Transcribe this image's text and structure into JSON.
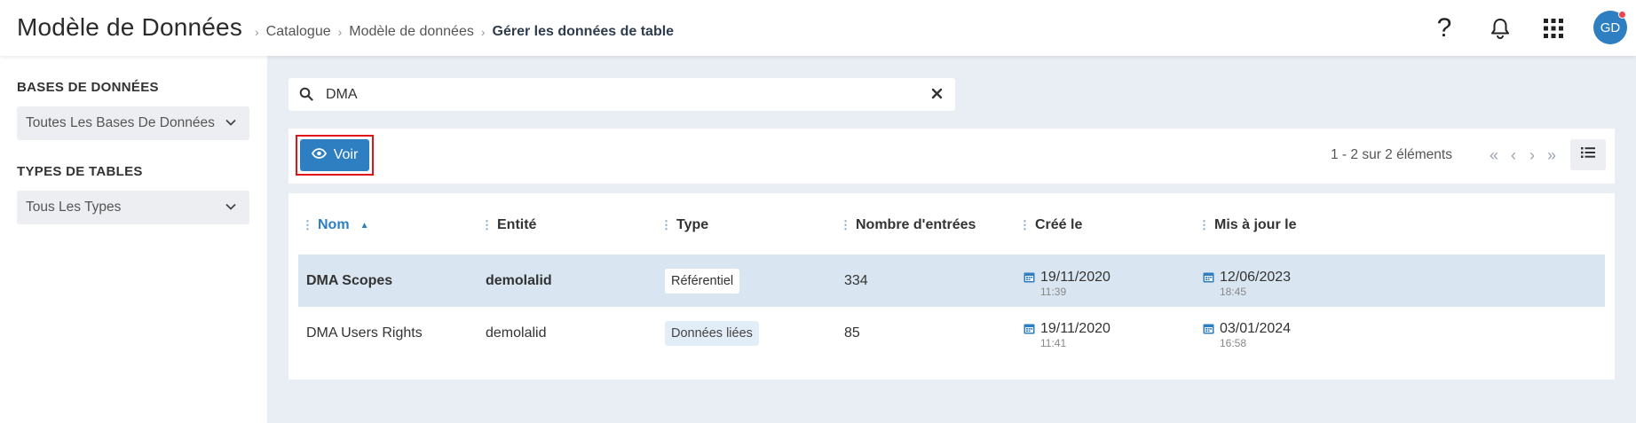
{
  "header": {
    "title": "Modèle de Données",
    "breadcrumb": [
      "Catalogue",
      "Modèle de données",
      "Gérer les données de table"
    ],
    "avatar_initials": "GD",
    "help_glyph": "?",
    "icons": [
      "help-icon",
      "bell-icon",
      "apps-grid-icon"
    ]
  },
  "sidebar": {
    "databases_heading": "BASES DE DONNÉES",
    "databases_selected": "Toutes Les Bases De Données",
    "types_heading": "TYPES DE TABLES",
    "types_selected": "Tous Les Types"
  },
  "search": {
    "value": "DMA",
    "placeholder": ""
  },
  "toolbar": {
    "voir_label": "Voir",
    "pagination": "1 - 2 sur 2 éléments",
    "pager_glyphs": [
      "«",
      "‹",
      "›",
      "»"
    ]
  },
  "table": {
    "columns": [
      "Nom",
      "Entité",
      "Type",
      "Nombre d'entrées",
      "Créé le",
      "Mis à jour le"
    ],
    "sorted_column": "Nom",
    "rows": [
      {
        "nom": "DMA Scopes",
        "entite": "demolalid",
        "type": "Référentiel",
        "entrees": "334",
        "cree_date": "19/11/2020",
        "cree_time": "11:39",
        "maj_date": "12/06/2023",
        "maj_time": "18:45",
        "selected": true
      },
      {
        "nom": "DMA Users Rights",
        "entite": "demolalid",
        "type": "Données liées",
        "entrees": "85",
        "cree_date": "19/11/2020",
        "cree_time": "11:41",
        "maj_date": "03/01/2024",
        "maj_time": "16:58",
        "selected": false
      }
    ]
  },
  "colors": {
    "accent": "#2d7fc1",
    "highlight_border": "#e0141b",
    "selected_row": "#d9e6f2",
    "main_background": "#e9eef5"
  }
}
